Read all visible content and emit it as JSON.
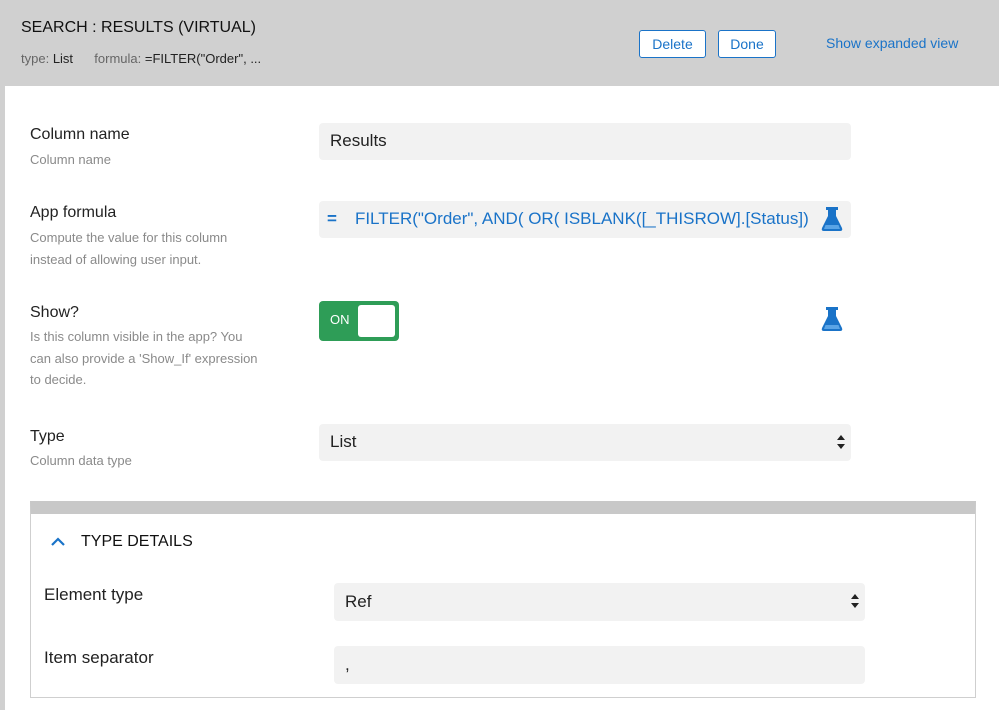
{
  "header": {
    "title": "SEARCH : RESULTS (VIRTUAL)",
    "type_label": "type:",
    "type_value": "List",
    "formula_label": "formula:",
    "formula_value": "=FILTER(\"Order\", ...",
    "delete_label": "Delete",
    "done_label": "Done",
    "expanded_link": "Show expanded view"
  },
  "fields": {
    "column_name": {
      "label": "Column name",
      "description": "Column name",
      "value": "Results"
    },
    "app_formula": {
      "label": "App formula",
      "description_line1": "Compute the value for this column",
      "description_line2": "instead of allowing user input.",
      "equals": "=",
      "value": "FILTER(\"Order\",    AND(    OR(  ISBLANK([_THISROW].[Status])"
    },
    "show": {
      "label": "Show?",
      "description_line1": "Is this column visible in the app? You",
      "description_line2": "can also provide a 'Show_If' expression",
      "description_line3": "to decide.",
      "toggle_text": "ON"
    },
    "type": {
      "label": "Type",
      "description": "Column data type",
      "value": "List"
    }
  },
  "type_details": {
    "title": "TYPE DETAILS",
    "element_type_label": "Element type",
    "element_type_value": "Ref",
    "item_separator_label": "Item separator",
    "item_separator_value": ","
  },
  "colors": {
    "accent": "#1a73c8",
    "toggle_on": "#2e9d57",
    "header_bg": "#d0d0d0"
  },
  "icons": [
    "flask-icon",
    "select-arrows-icon",
    "chevron-up-icon"
  ]
}
